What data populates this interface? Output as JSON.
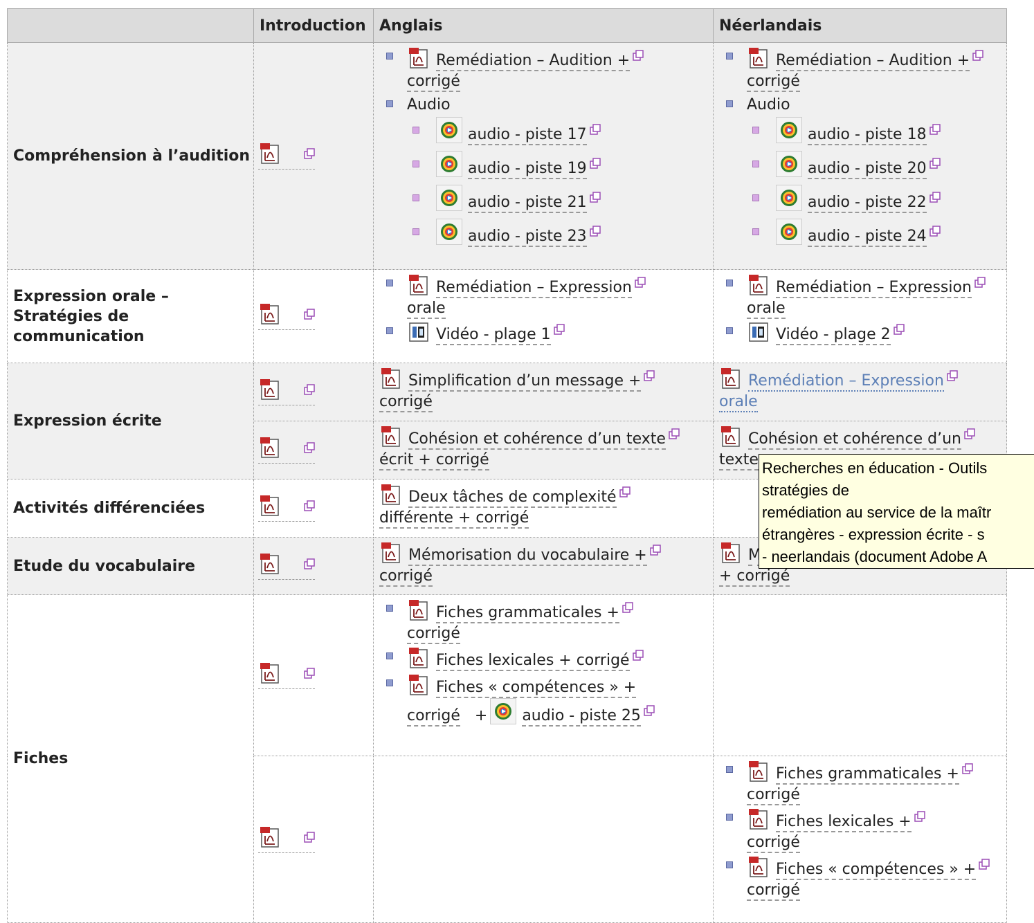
{
  "header": {
    "col_blank": "",
    "col_intro": "Introduction",
    "col_en": "Anglais",
    "col_nl": "Néerlandais"
  },
  "rows": {
    "audition": {
      "label": "Compréhension à l’audition",
      "en": {
        "doc_a": "Remédiation – Audition +",
        "doc_b": "corrigé",
        "audio_label": "Audio",
        "tracks": [
          "audio - piste 17",
          "audio - piste 19",
          "audio - piste 21",
          "audio - piste 23"
        ]
      },
      "nl": {
        "doc_a": "Remédiation – Audition +",
        "doc_b": "corrigé",
        "audio_label": "Audio",
        "tracks": [
          "audio - piste 18",
          "audio - piste 20",
          "audio - piste 22",
          "audio - piste 24"
        ]
      }
    },
    "orale": {
      "label_1": "Expression orale –",
      "label_2": "Stratégies de",
      "label_3": "communication",
      "en": {
        "doc_a": "Remédiation – Expression",
        "doc_b": "orale",
        "video": "Vidéo - plage 1"
      },
      "nl": {
        "doc_a": "Remédiation – Expression",
        "doc_b": "orale",
        "video": "Vidéo - plage 2"
      }
    },
    "ecrite": {
      "label": "Expression écrite",
      "en1": {
        "a": "Simplification d’un message +",
        "b": "corrigé"
      },
      "nl1": {
        "a": "Remédiation – Expression",
        "b": "orale"
      },
      "en2": {
        "a": "Cohésion et cohérence d’un texte",
        "b": "écrit + corrigé"
      },
      "nl2": {
        "a": "Cohésion et cohérence d’un",
        "b": "texte"
      }
    },
    "diff": {
      "label": "Activités différenciées",
      "en": {
        "a": "Deux tâches de complexité",
        "b": "différente + corrigé"
      }
    },
    "vocab": {
      "label": "Etude du vocabulaire",
      "en": {
        "a": "Mémorisation du vocabulaire +",
        "b": "corrigé"
      },
      "nl": {
        "a": "M",
        "b": "+ corrigé"
      }
    },
    "fiches": {
      "label": "Fiches",
      "en": {
        "gram_a": "Fiches grammaticales +",
        "gram_b": "corrigé",
        "lex": "Fiches lexicales + corrigé",
        "comp_a": "Fiches « compétences » +",
        "comp_b": "corrigé",
        "comp_plus": "+",
        "audio": "audio - piste 25"
      },
      "nl": {
        "gram_a": "Fiches grammaticales +",
        "gram_b": "corrigé",
        "lex_a": "Fiches lexicales +",
        "lex_b": "corrigé",
        "comp_a": "Fiches « compétences » +",
        "comp_b": "corrigé"
      }
    }
  },
  "tooltip": {
    "line1": "Recherches en éducation - Outils",
    "line2": "stratégies de",
    "line3": "remédiation au service de la maîtr",
    "line4": "étrangères - expression écrite - s",
    "line5": "- neerlandais (document Adobe A"
  },
  "icons": {
    "pdf": "pdf-icon",
    "audio": "audio-file-icon",
    "video": "video-file-icon",
    "external": "new-window-icon"
  }
}
